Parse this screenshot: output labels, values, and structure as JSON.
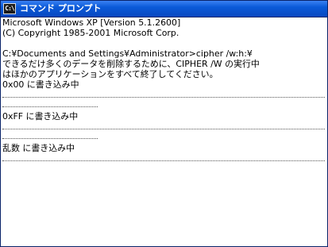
{
  "window": {
    "title": "コマンド プロンプト",
    "icon": "cmd-icon",
    "icon_text": "C:\\"
  },
  "console": {
    "lines": [
      "Microsoft Windows XP [Version 5.1.2600]",
      "(C) Copyright 1985-2001 Microsoft Corp.",
      "",
      "C:¥Documents and Settings¥Administrator>cipher /w:h:¥",
      "できるだけ多くのデータを削除するために、CIPHER /W の実行中",
      "はほかのアプリケーションをすべて終了してください。",
      "0x00 に書き込み中",
      "0xFF に書き込み中",
      "乱数 に書き込み中"
    ]
  },
  "colors": {
    "titlebar": "#0a5ad8",
    "console_background": "#ffffff",
    "console_text": "#000000"
  }
}
